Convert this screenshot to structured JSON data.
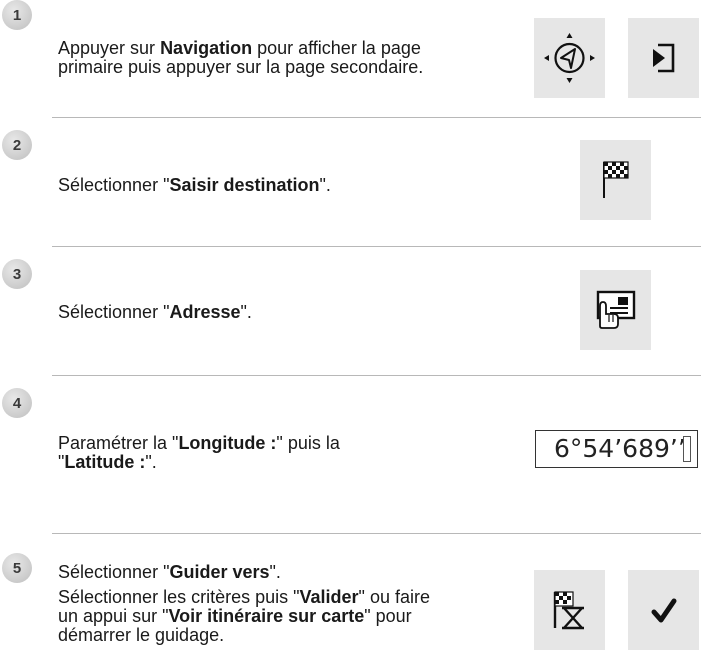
{
  "steps": [
    {
      "number": "1",
      "lines": [
        {
          "pre": "Appuyer sur ",
          "bold": "Navigation",
          "post": " pour afficher la page"
        },
        {
          "pre": "primaire puis appuyer sur la page secondaire.",
          "bold": "",
          "post": ""
        }
      ],
      "icons": [
        "navigation-compass-icon",
        "secondary-page-icon"
      ]
    },
    {
      "number": "2",
      "lines": [
        {
          "pre": "Sélectionner \"",
          "bold": "Saisir destination",
          "post": "\"."
        }
      ],
      "icons": [
        "checkered-flag-icon"
      ]
    },
    {
      "number": "3",
      "lines": [
        {
          "pre": "Sélectionner \"",
          "bold": "Adresse",
          "post": "\"."
        }
      ],
      "icons": [
        "hand-address-card-icon"
      ]
    },
    {
      "number": "4",
      "lines": [
        {
          "pre": "Paramétrer la \"",
          "bold": "Longitude :",
          "post": "\" puis la"
        },
        {
          "pre": "\"",
          "bold": "Latitude :",
          "post": "\"."
        }
      ],
      "coordinate_display": "6°54’689’’"
    },
    {
      "number": "5",
      "lines": [
        {
          "pre": "Sélectionner \"",
          "bold": "Guider vers",
          "post": "\"."
        },
        {
          "pre": "Sélectionner les critères puis \"",
          "bold": "Valider",
          "post": "\" ou faire"
        },
        {
          "pre": "un appui sur \"",
          "bold": "Voir itinéraire sur carte",
          "post": "\" pour"
        },
        {
          "pre": "démarrer le guidage.",
          "bold": "",
          "post": ""
        }
      ],
      "icons": [
        "flag-hourglass-icon",
        "checkmark-icon"
      ]
    }
  ]
}
